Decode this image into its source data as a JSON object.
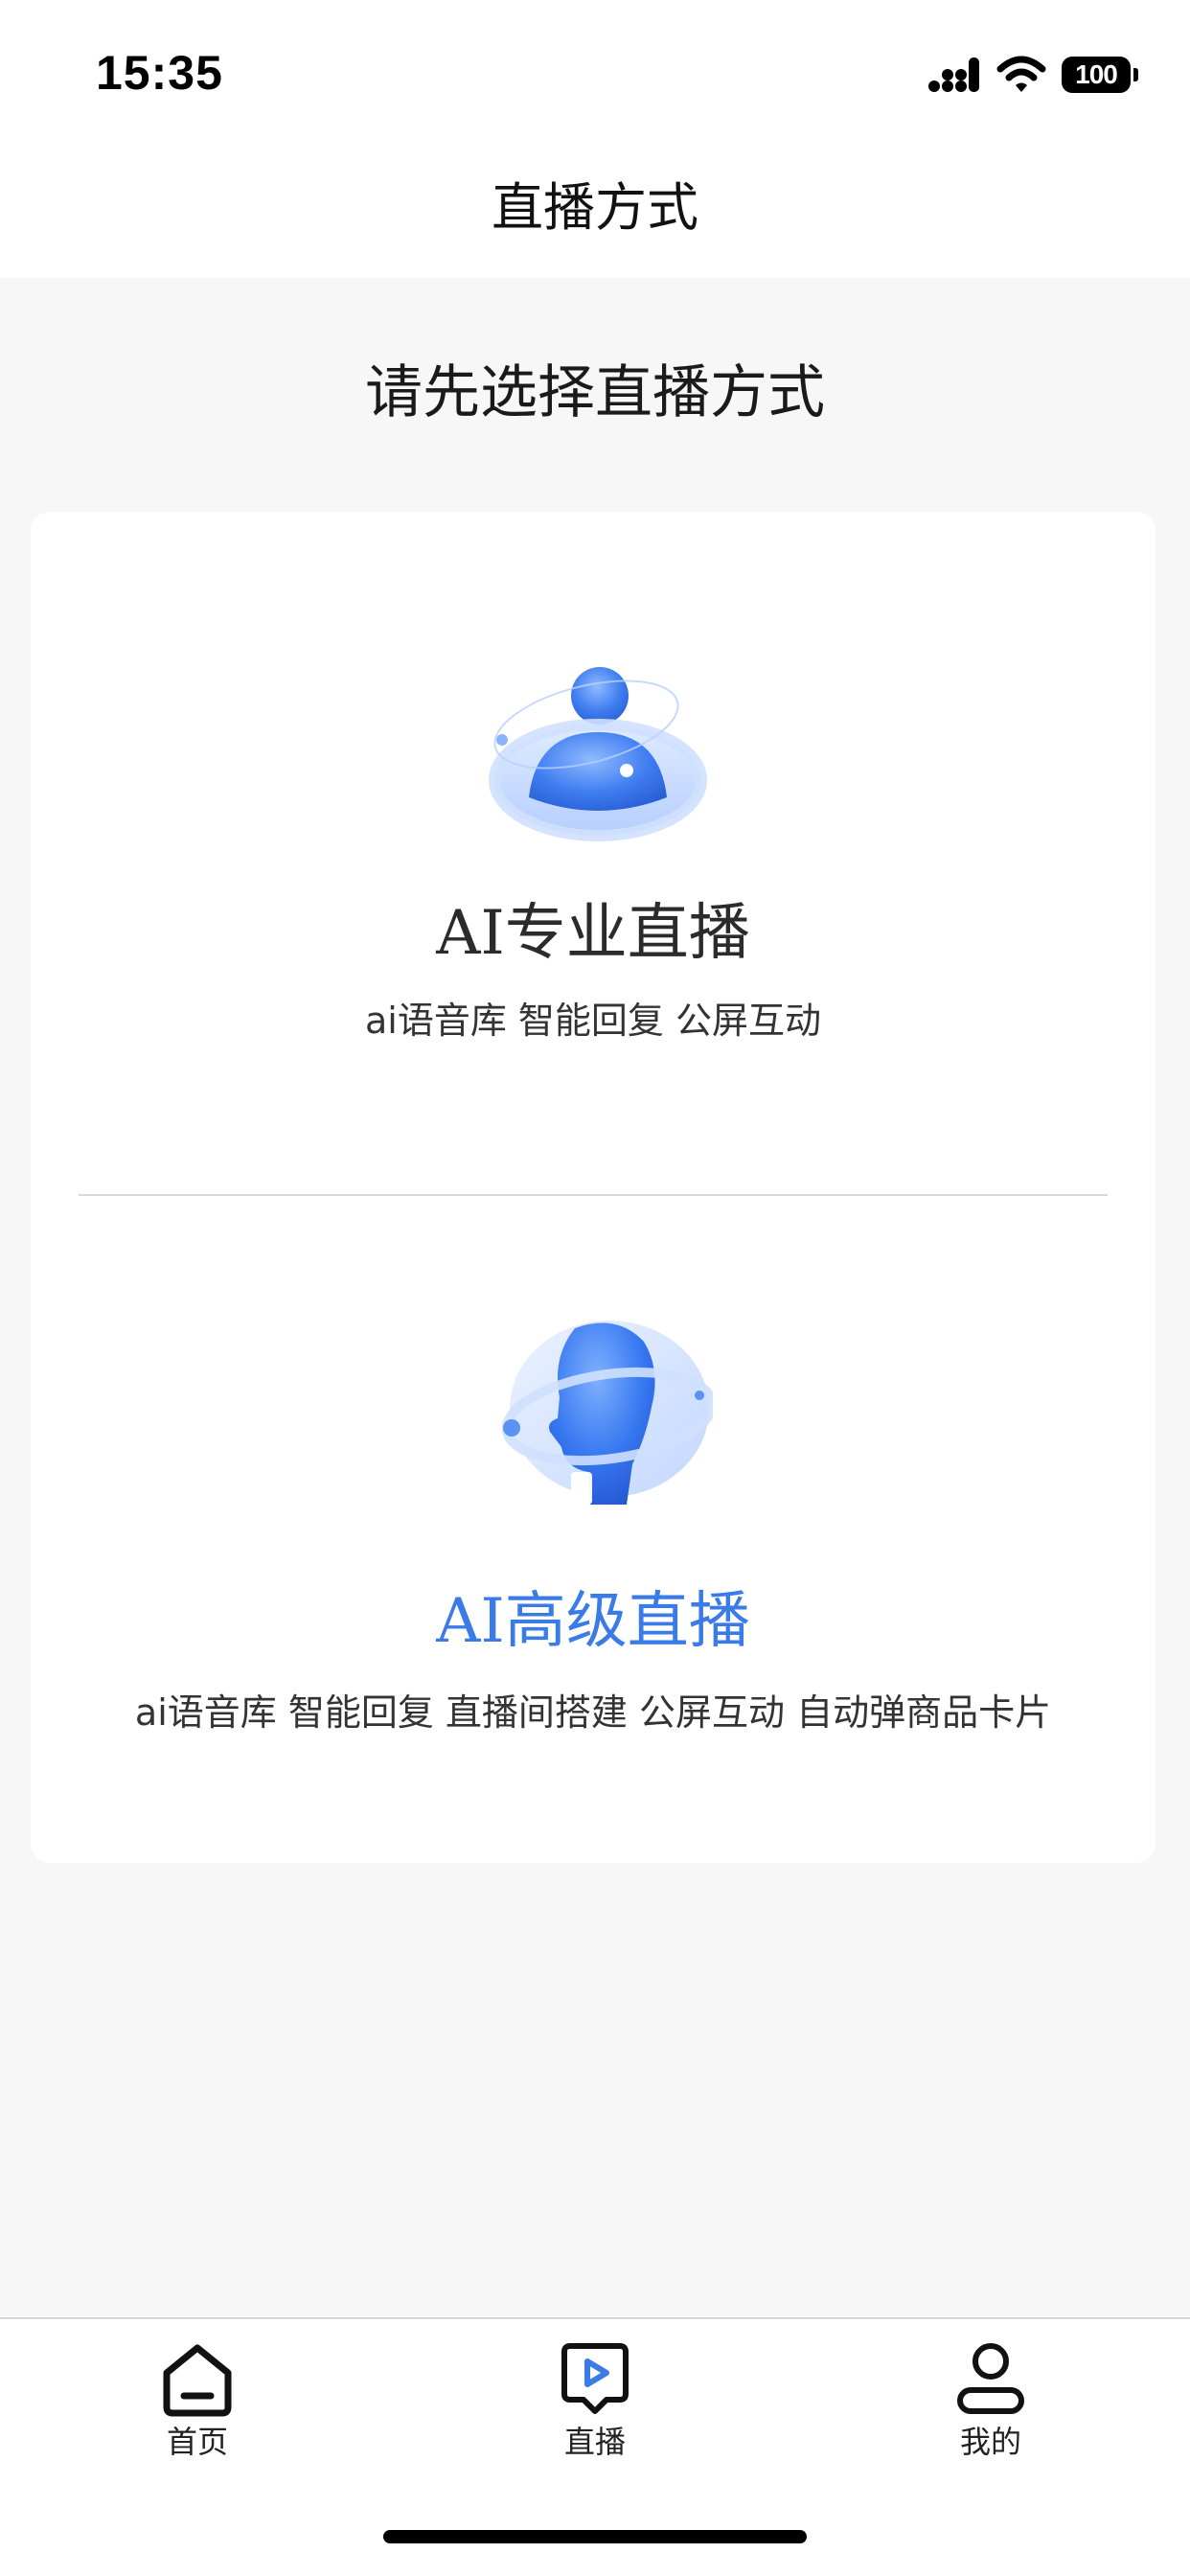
{
  "status_bar": {
    "time": "15:35",
    "battery_level": "100",
    "icons": [
      "signal-icon",
      "wifi-icon",
      "battery-icon"
    ]
  },
  "nav": {
    "title": "直播方式"
  },
  "content": {
    "prompt": "请先选择直播方式",
    "options": [
      {
        "title": "AI专业直播",
        "description": "ai语音库 智能回复 公屏互动",
        "icon": "ai-avatar-orbit-icon",
        "selected": false
      },
      {
        "title": "AI高级直播",
        "description": "ai语音库 智能回复 直播间搭建 公屏互动 自动弹商品卡片",
        "icon": "ai-head-orbit-icon",
        "selected": true
      }
    ]
  },
  "tab_bar": {
    "tabs": [
      {
        "label": "首页",
        "icon": "home-icon"
      },
      {
        "label": "直播",
        "icon": "live-icon"
      },
      {
        "label": "我的",
        "icon": "profile-icon"
      }
    ]
  },
  "colors": {
    "accent": "#3b7be8",
    "background": "#f7f7f7",
    "card": "#ffffff",
    "divider": "#d9d9d9"
  }
}
